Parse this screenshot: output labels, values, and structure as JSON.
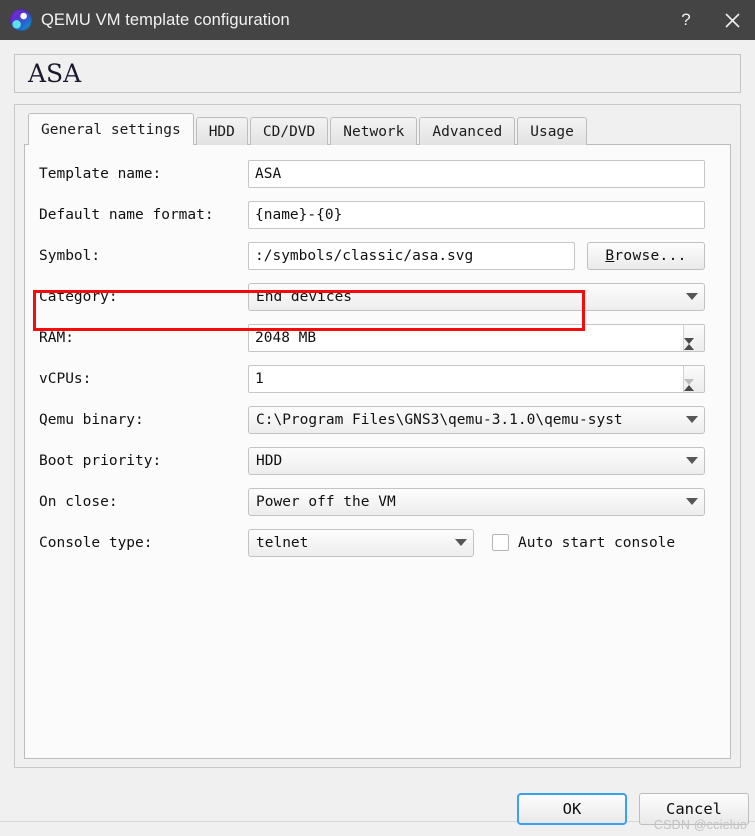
{
  "window": {
    "title": "QEMU VM template configuration",
    "help_label": "?",
    "close_label": "×",
    "logo_icon": "gns3-logo-icon",
    "titlebar_color": "#444444"
  },
  "heading": {
    "text": "ASA"
  },
  "tabs": [
    {
      "label": "General settings",
      "active": true
    },
    {
      "label": "HDD",
      "active": false
    },
    {
      "label": "CD/DVD",
      "active": false
    },
    {
      "label": "Network",
      "active": false
    },
    {
      "label": "Advanced",
      "active": false
    },
    {
      "label": "Usage",
      "active": false
    }
  ],
  "form": {
    "template_name": {
      "label": "Template name:",
      "value": "ASA"
    },
    "default_name_format": {
      "label": "Default name format:",
      "value": "{name}-{0}"
    },
    "symbol": {
      "label": "Symbol:",
      "value": ":/symbols/classic/asa.svg",
      "browse_label": "Browse...",
      "browse_mnemonic": "B",
      "browse_rest": "rowse..."
    },
    "category": {
      "label": "Category:",
      "value": "End devices"
    },
    "ram": {
      "label": "RAM:",
      "value": "2048 MB"
    },
    "vcpus": {
      "label": "vCPUs:",
      "value": "1"
    },
    "qemu_binary": {
      "label": "Qemu binary:",
      "value": "C:\\Program Files\\GNS3\\qemu-3.1.0\\qemu-syst"
    },
    "boot_priority": {
      "label": "Boot priority:",
      "value": "HDD"
    },
    "on_close": {
      "label": "On close:",
      "value": "Power off the VM"
    },
    "console_type": {
      "label": "Console type:",
      "value": "telnet"
    },
    "auto_start_console": {
      "label": "Auto start console",
      "checked": false
    }
  },
  "annotation": {
    "color": "#f40b0b",
    "target": "symbol-row"
  },
  "footer": {
    "ok_label": "OK",
    "cancel_label": "Cancel"
  },
  "watermark": {
    "text": "CSDN @ccieluo"
  }
}
